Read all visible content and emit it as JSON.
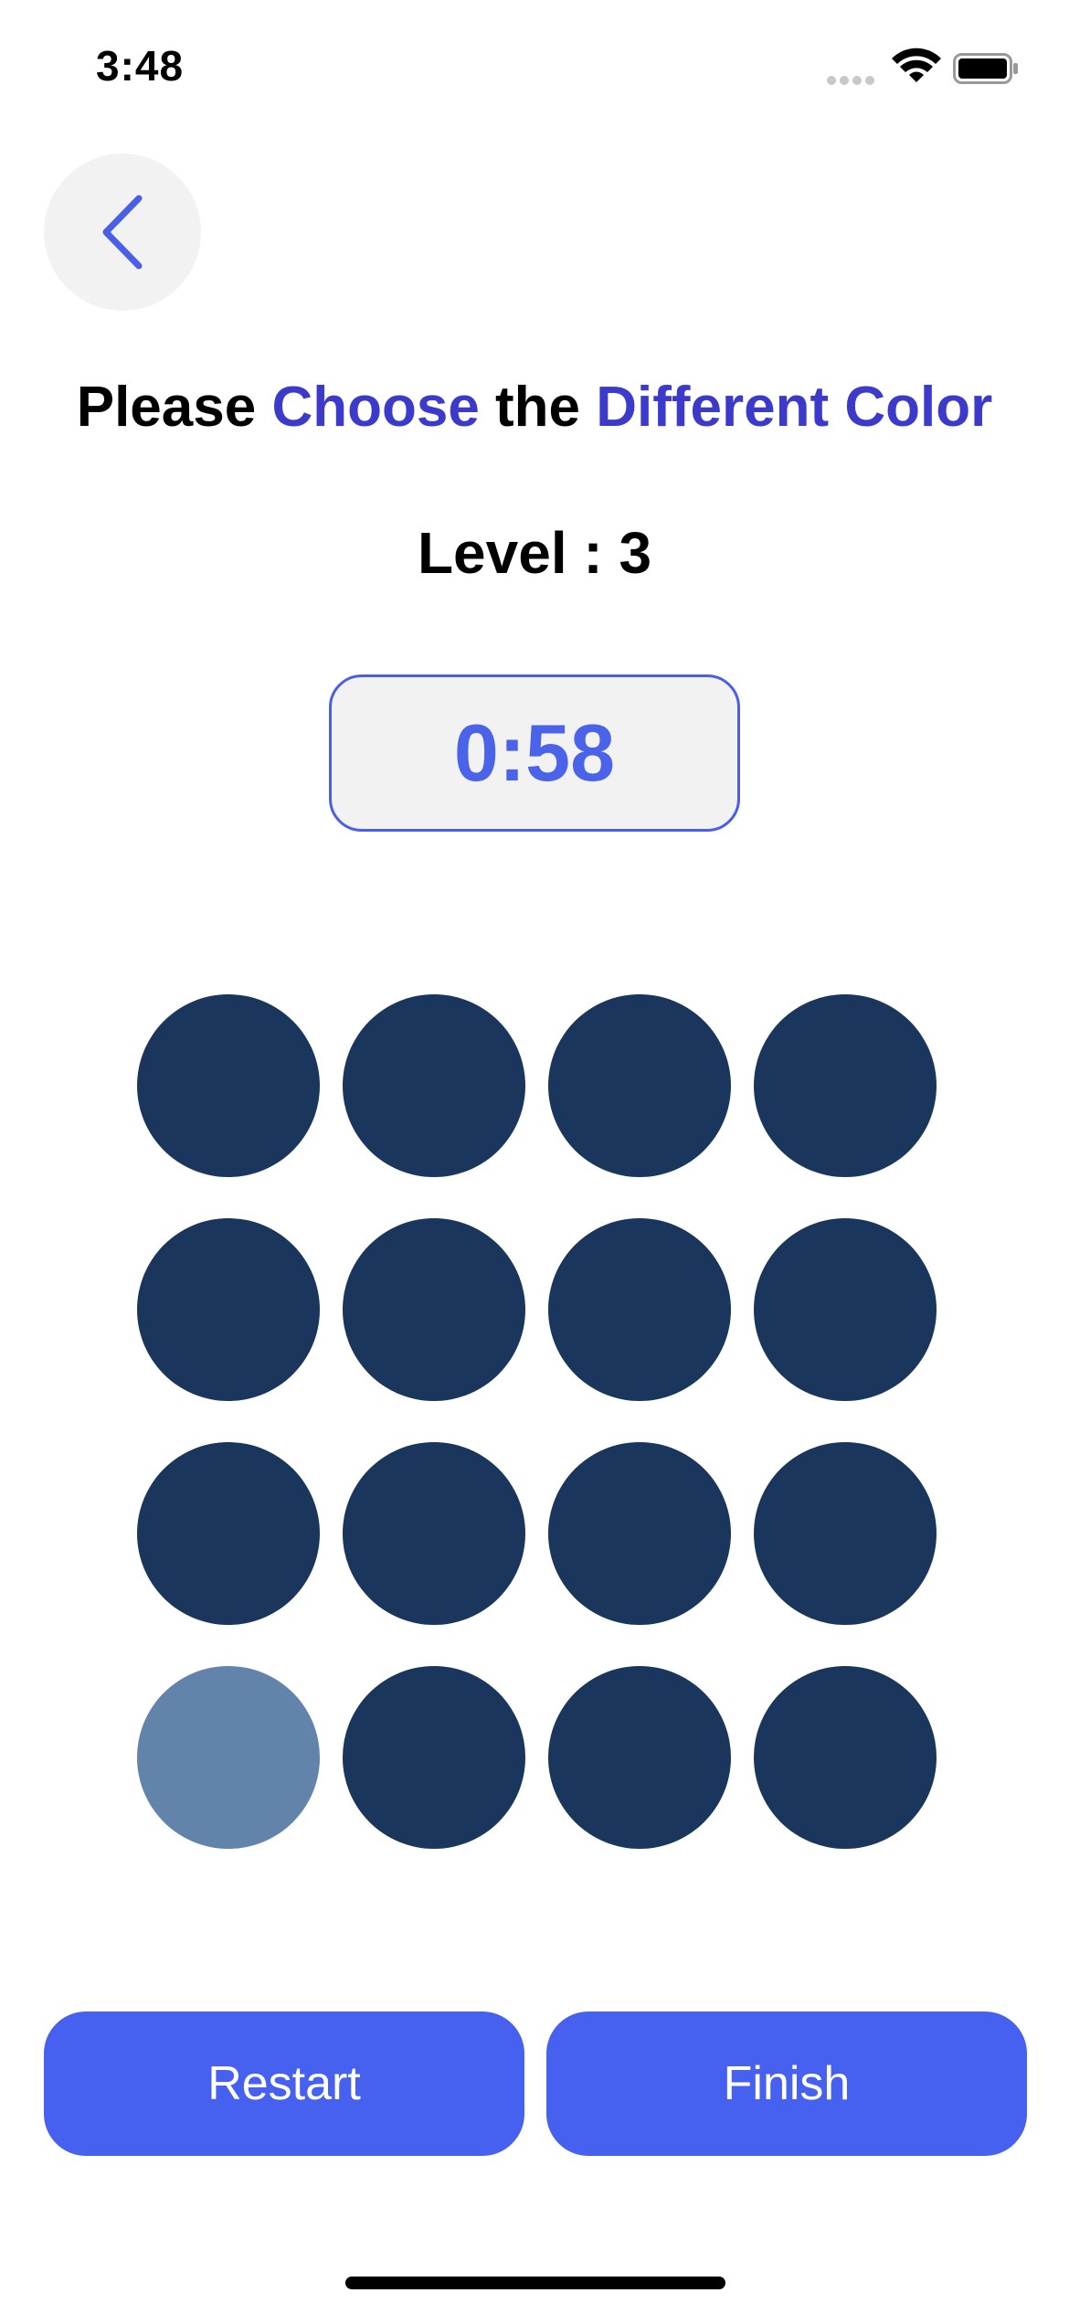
{
  "status_bar": {
    "time": "3:48"
  },
  "icons": {
    "back": "chevron-left-icon",
    "wifi": "wifi-icon",
    "battery": "battery-icon",
    "signal": "cellular-signal-icon"
  },
  "header": {
    "title_parts": [
      "Please ",
      "Choose",
      " the ",
      "Different Color"
    ],
    "level_label": "Level : 3"
  },
  "timer": {
    "value": "0:58"
  },
  "grid": {
    "rows": 4,
    "columns": 4,
    "base_color": "#1a365d",
    "odd_color": "#6283aa",
    "odd_index": 12
  },
  "buttons": {
    "restart_label": "Restart",
    "finish_label": "Finish"
  },
  "colors": {
    "accent_title": "#3b3acb",
    "button_bg": "#4661ef",
    "timer_text": "#4a63e8"
  }
}
